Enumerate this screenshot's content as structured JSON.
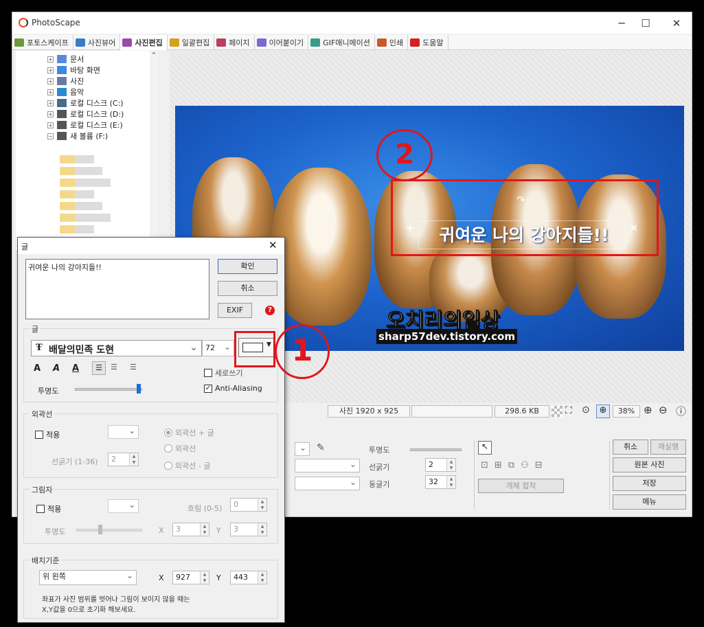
{
  "app": {
    "title": "PhotoScape"
  },
  "window_buttons": {
    "minimize": "─",
    "maximize": "☐",
    "close": "✕"
  },
  "tabs": [
    {
      "label": "포토스케이프",
      "color": "#6a9a3a"
    },
    {
      "label": "사진뷰어",
      "color": "#3a7cc4"
    },
    {
      "label": "사진편집",
      "color": "#9a4aa8"
    },
    {
      "label": "일괄편집",
      "color": "#d4a020"
    },
    {
      "label": "페이지",
      "color": "#b84060"
    },
    {
      "label": "이어붙이기",
      "color": "#7a6ad0"
    },
    {
      "label": "GIF애니메이션",
      "color": "#3a9a8a"
    },
    {
      "label": "인쇄",
      "color": "#c85a2a"
    },
    {
      "label": "도움말",
      "color": "#d42020"
    }
  ],
  "active_tab_index": 2,
  "tree": {
    "items": [
      {
        "label": "문서",
        "color": "#5a8ad8"
      },
      {
        "label": "바탕 화면",
        "color": "#3a8ae0"
      },
      {
        "label": "사진",
        "color": "#6a7aa8"
      },
      {
        "label": "음악",
        "color": "#2a8ad0"
      },
      {
        "label": "로컬 디스크 (C:)",
        "color": "#4a6a8a"
      },
      {
        "label": "로컬 디스크 (D:)",
        "color": "#555555"
      },
      {
        "label": "로컬 디스크 (E:)",
        "color": "#555555"
      },
      {
        "label": "새 볼륨 (F:)",
        "color": "#555555"
      }
    ],
    "scroll_up": "⌃"
  },
  "photo": {
    "caption": "귀여운 나의 강아지들!!",
    "watermark_title": "오치리의일상",
    "watermark_url": "sharp57dev.tistory.com"
  },
  "status": {
    "dimensions": "사진 1920 x 925",
    "filesize": "298.6 KB",
    "zoom": "38%"
  },
  "bottom_panel": {
    "opacity_label": "투명도",
    "line_width_label": "선굵기",
    "line_width_value": "2",
    "roundness_label": "둥글기",
    "roundness_value": "32",
    "attach_button": "개체 접착",
    "cancel_button": "취소",
    "redo_button": "재실행",
    "original_button": "원본 사진",
    "save_button": "저장",
    "menu_button": "메뉴"
  },
  "dialog": {
    "title": "글",
    "close": "✕",
    "text_value": "귀여운 나의 강아지들!!",
    "ok_button": "확인",
    "cancel_button": "취소",
    "exif_button": "EXIF",
    "help_icon": "?",
    "font_group_title": "글",
    "font_name": "배달의민족 도현",
    "font_icon": "Ŧ",
    "font_size": "72",
    "text_color": "#ffffff",
    "style_bold": "A",
    "style_italic": "A",
    "style_underline": "A",
    "vertical_label": "세로쓰기",
    "vertical_checked": false,
    "antialias_label": "Anti-Aliasing",
    "antialias_checked": true,
    "opacity_label": "투명도",
    "opacity_value": 0.92,
    "outline_group": "외곽선",
    "outline_apply": "적용",
    "outline_opt1": "외곽선 + 글",
    "outline_opt2": "외곽선",
    "outline_opt3": "외곽선 - 글",
    "outline_width_label": "선굵기 (1-36)",
    "outline_width_value": "2",
    "shadow_group": "그림자",
    "shadow_apply": "적용",
    "shadow_blur_label": "흐림 (0-5)",
    "shadow_blur_value": "0",
    "shadow_opacity_label": "투명도",
    "shadow_opacity_value": 0.33,
    "shadow_x_label": "X",
    "shadow_x_value": "3",
    "shadow_y_label": "Y",
    "shadow_y_value": "3",
    "anchor_group": "배치기준",
    "anchor_value": "위 왼쪽",
    "pos_x_label": "X",
    "pos_x_value": "927",
    "pos_y_label": "Y",
    "pos_y_value": "443",
    "hint_line1": "좌표가 사진 범위를 벗어나 그림이 보이지 않을 때는",
    "hint_line2": "X,Y값을 0으로 초기화 해보세요."
  },
  "annotations": {
    "marker1": "1",
    "marker2": "2",
    "color": "#e0161b"
  }
}
